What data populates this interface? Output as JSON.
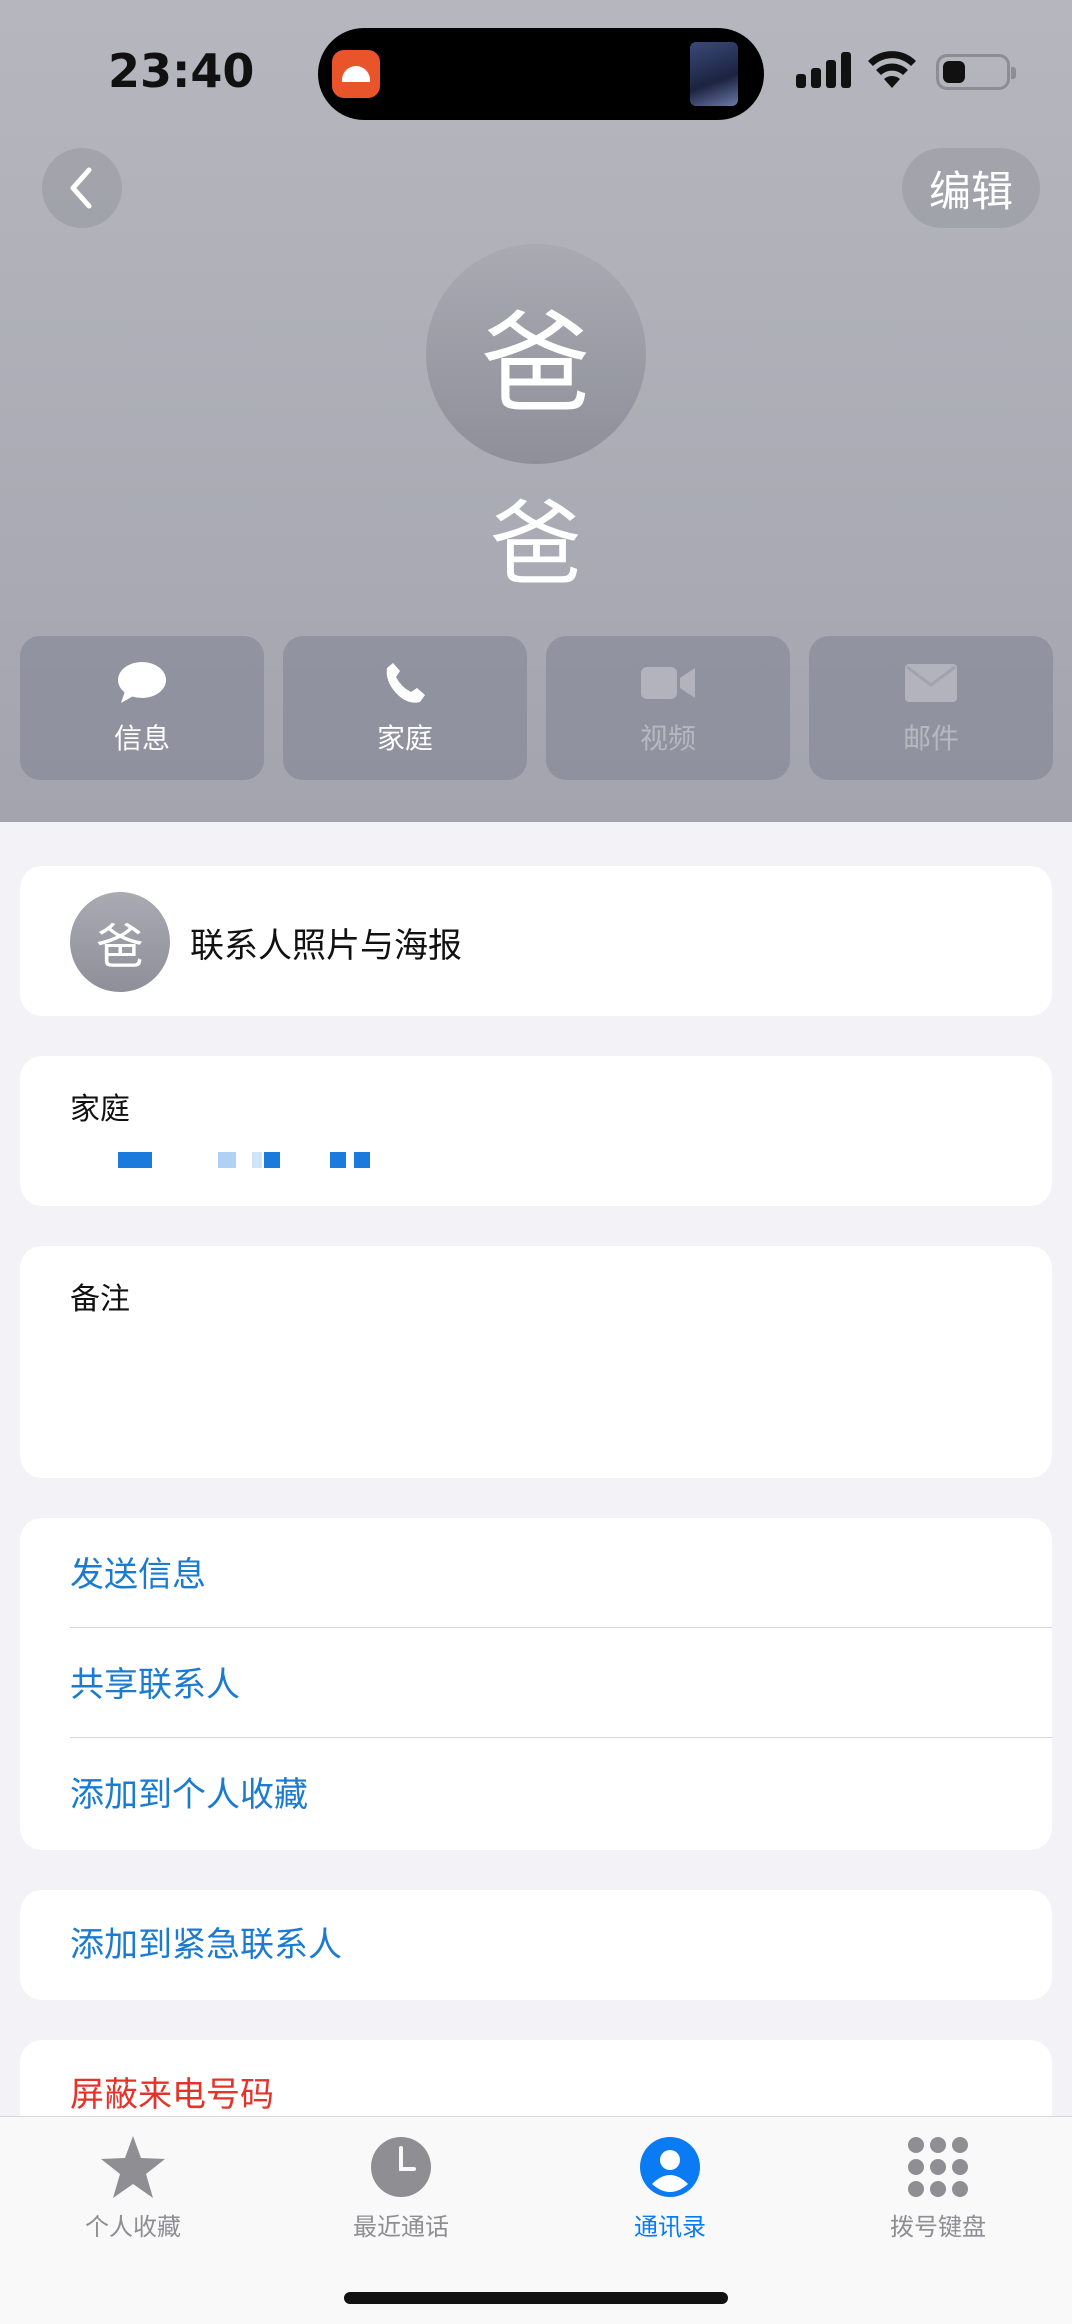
{
  "status_bar": {
    "time": "23:40",
    "signal_icon": "cellular-signal-icon",
    "wifi_icon": "wifi-icon",
    "battery_icon": "battery-icon",
    "battery_level": 0.35
  },
  "nav": {
    "back_icon": "chevron-left-icon",
    "edit_label": "编辑"
  },
  "contact": {
    "avatar_initial": "爸",
    "name": "爸"
  },
  "actions": [
    {
      "label": "信息",
      "icon": "message-bubble-icon",
      "enabled": true
    },
    {
      "label": "家庭",
      "icon": "phone-icon",
      "enabled": true
    },
    {
      "label": "视频",
      "icon": "video-camera-icon",
      "enabled": false
    },
    {
      "label": "邮件",
      "icon": "mail-icon",
      "enabled": false
    }
  ],
  "poster_card": {
    "avatar_initial": "爸",
    "label": "联系人照片与海报"
  },
  "phone_card": {
    "label": "家庭"
  },
  "notes_card": {
    "label": "备注"
  },
  "options_group": {
    "send_message": "发送信息",
    "share_contact": "共享联系人",
    "add_favorites": "添加到个人收藏"
  },
  "emergency": {
    "label": "添加到紧急联系人"
  },
  "block": {
    "label": "屏蔽来电号码"
  },
  "tabs": [
    {
      "label": "个人收藏",
      "icon": "star-icon",
      "active": false
    },
    {
      "label": "最近通话",
      "icon": "clock-icon",
      "active": false
    },
    {
      "label": "通讯录",
      "icon": "person-circle-icon",
      "active": true
    },
    {
      "label": "拨号键盘",
      "icon": "keypad-icon",
      "active": false
    }
  ],
  "colors": {
    "link_blue": "#1a7bd0",
    "destructive_red": "#e5322b",
    "active_tab_blue": "#0a7bf2"
  }
}
